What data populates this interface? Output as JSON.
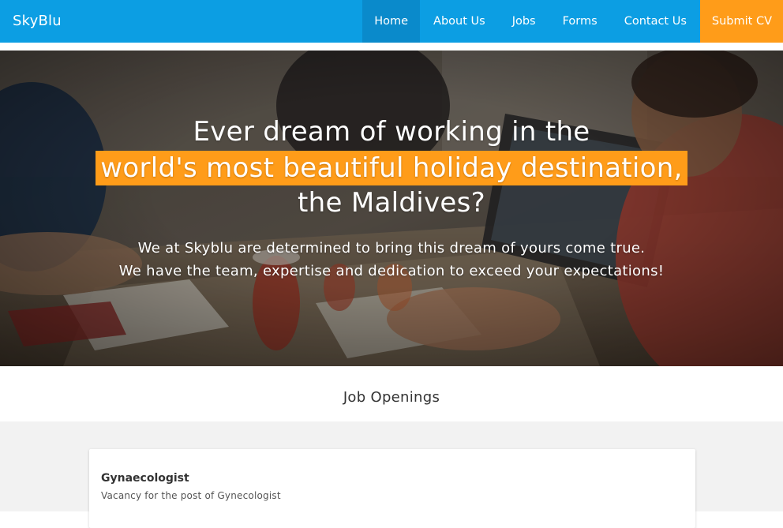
{
  "navbar": {
    "brand": "SkyBlu",
    "items": [
      {
        "label": "Home"
      },
      {
        "label": "About Us"
      },
      {
        "label": "Jobs"
      },
      {
        "label": "Forms"
      },
      {
        "label": "Contact Us"
      }
    ],
    "cta_label": "Submit CV"
  },
  "hero": {
    "line1": "Ever dream of working in the",
    "line2": "world's most beautiful holiday destination,",
    "line3": "the Maldives?",
    "sub1": "We at Skyblu are determined to bring this dream of yours come true.",
    "sub2": "We have the team, expertise and dedication to exceed your expectations!"
  },
  "jobs": {
    "title": "Job Openings",
    "items": [
      {
        "title": "Gynaecologist",
        "description": "Vacancy for the post of Gynecologist"
      }
    ]
  },
  "colors": {
    "primary": "#0c9ee3",
    "primary_active": "#0a8acb",
    "accent": "#ff9c19"
  }
}
